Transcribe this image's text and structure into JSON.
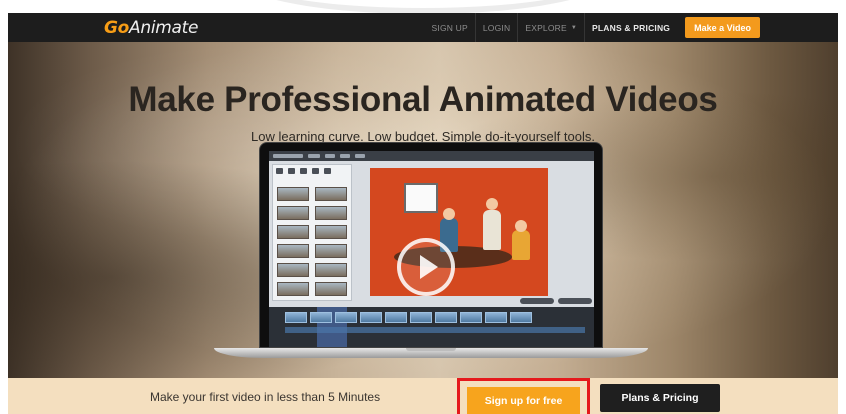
{
  "navbar": {
    "logo_go": "Go",
    "logo_animate": "Animate",
    "items": [
      {
        "label": "SIGN UP"
      },
      {
        "label": "LOGIN"
      },
      {
        "label": "EXPLORE"
      },
      {
        "label": "PLANS & PRICING"
      }
    ],
    "cta_label": "Make a Video"
  },
  "hero": {
    "title": "Make Professional Animated Videos",
    "subtitle": "Low learning curve. Low budget. Simple do-it-yourself tools."
  },
  "strip": {
    "text": "Make your first video in less than 5 Minutes",
    "signup_label": "Sign up for free",
    "plans_label": "Plans & Pricing"
  },
  "colors": {
    "brand_orange": "#f39a1d",
    "nav_bg": "#1d1d1d",
    "highlight_red": "#e5191c"
  },
  "icons": {
    "play": "play-icon",
    "explore_caret": "chevron-down-icon"
  }
}
